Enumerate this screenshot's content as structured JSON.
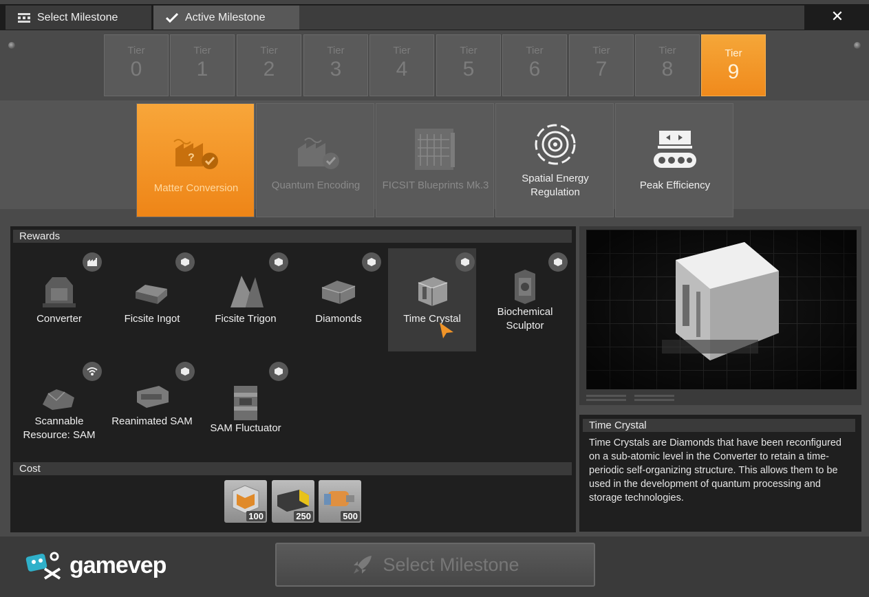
{
  "topbar": {
    "tabs": [
      {
        "label": "Select Milestone",
        "icon": "grid-icon"
      },
      {
        "label": "Active Milestone",
        "icon": "check-icon"
      }
    ],
    "close_icon": "close-icon"
  },
  "tiers": {
    "label": "Tier",
    "numbers": [
      "0",
      "1",
      "2",
      "3",
      "4",
      "5",
      "6",
      "7",
      "8",
      "9"
    ],
    "selected": "9"
  },
  "schematics": [
    {
      "label": "Matter Conversion",
      "icon": "factory-check-icon",
      "state": "selected"
    },
    {
      "label": "Quantum Encoding",
      "icon": "factory-check-icon",
      "state": "dimmed"
    },
    {
      "label": "FICSIT Blueprints Mk.3",
      "icon": "blueprint-icon",
      "state": "dimmed"
    },
    {
      "label": "Spatial Energy Regulation",
      "icon": "energy-rings-icon",
      "state": "normal"
    },
    {
      "label": "Peak Efficiency",
      "icon": "conveyor-icon",
      "state": "normal"
    }
  ],
  "rewards": {
    "header": "Rewards",
    "items": [
      {
        "label": "Converter",
        "badge": "building-icon"
      },
      {
        "label": "Ficsite Ingot",
        "badge": "item-icon"
      },
      {
        "label": "Ficsite Trigon",
        "badge": "item-icon"
      },
      {
        "label": "Diamonds",
        "badge": "item-icon"
      },
      {
        "label": "Time Crystal",
        "badge": "item-icon",
        "highlighted": true
      },
      {
        "label": "Biochemical Sculptor",
        "badge": "item-icon"
      },
      {
        "label": "Scannable Resource: SAM",
        "badge": "scan-icon"
      },
      {
        "label": "Reanimated SAM",
        "badge": "item-icon"
      },
      {
        "label": "SAM Fluctuator",
        "badge": "item-icon"
      }
    ]
  },
  "cost": {
    "header": "Cost",
    "items": [
      {
        "amount": "100",
        "icon": "frame-item-icon"
      },
      {
        "amount": "250",
        "icon": "battery-item-icon"
      },
      {
        "amount": "500",
        "icon": "motor-item-icon"
      }
    ]
  },
  "detail": {
    "title": "Time Crystal",
    "description": "Time Crystals are Diamonds that have been reconfigured on a sub-atomic level in the Converter to retain a time-periodic self-organizing structure. This allows them to be used in the development of quantum processing and storage technologies."
  },
  "footer": {
    "select_button": "Select Milestone",
    "select_icon": "rocket-icon",
    "logo_text": "gamevep"
  },
  "colors": {
    "accent": "#f29320",
    "panel_dark": "#1f1f1f",
    "frame": "#4a4a4a"
  }
}
